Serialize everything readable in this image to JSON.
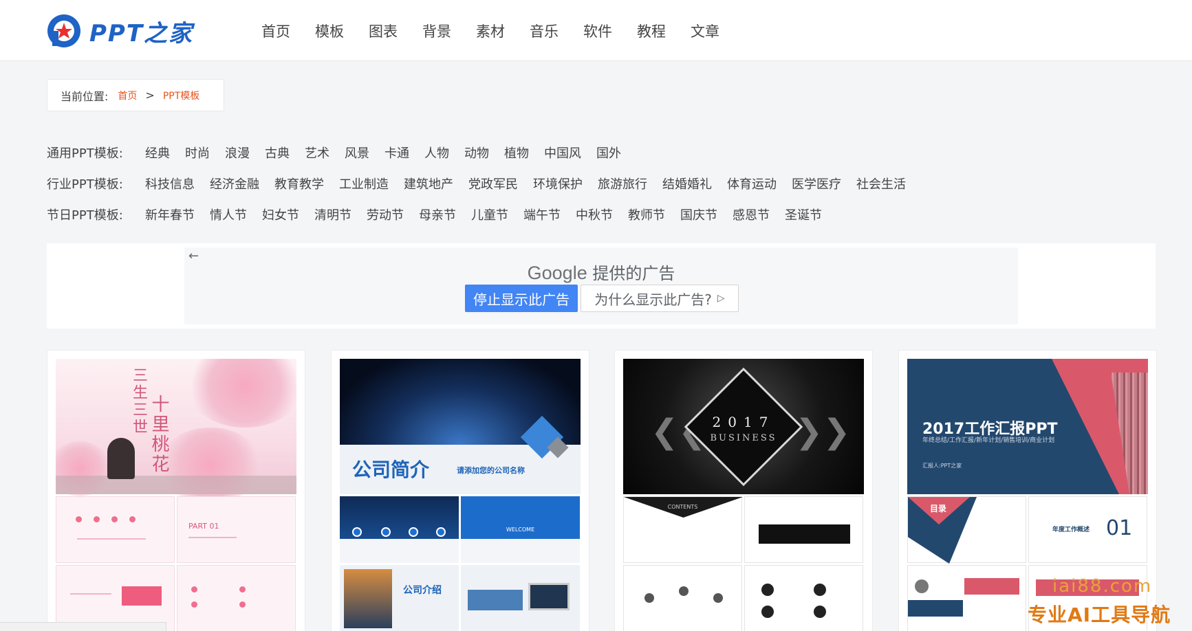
{
  "header": {
    "logo_text": "PPT之家",
    "nav": [
      "首页",
      "模板",
      "图表",
      "背景",
      "素材",
      "音乐",
      "软件",
      "教程",
      "文章"
    ]
  },
  "breadcrumb": {
    "label": "当前位置:",
    "home": "首页",
    "separator": ">",
    "current": "PPT模板"
  },
  "categories": [
    {
      "title": "通用PPT模板:",
      "items": [
        "经典",
        "时尚",
        "浪漫",
        "古典",
        "艺术",
        "风景",
        "卡通",
        "人物",
        "动物",
        "植物",
        "中国风",
        "国外"
      ]
    },
    {
      "title": "行业PPT模板:",
      "items": [
        "科技信息",
        "经济金融",
        "教育教学",
        "工业制造",
        "建筑地产",
        "党政军民",
        "环境保护",
        "旅游旅行",
        "结婚婚礼",
        "体育运动",
        "医学医疗",
        "社会生活"
      ]
    },
    {
      "title": "节日PPT模板:",
      "items": [
        "新年春节",
        "情人节",
        "妇女节",
        "清明节",
        "劳动节",
        "母亲节",
        "儿童节",
        "端午节",
        "中秋节",
        "教师节",
        "国庆节",
        "感恩节",
        "圣诞节"
      ]
    }
  ],
  "ad": {
    "brand": "Google",
    "title": "提供的广告",
    "stop_button": "停止显示此广告",
    "why_button": "为什么显示此广告?",
    "back_icon": "arrow-left-icon"
  },
  "cards": [
    {
      "vertical_text_1": "三生三世",
      "vertical_text_2": "十里桃花",
      "part_label": "PART 01"
    },
    {
      "title": "公司简介",
      "subtitle": "请添加您的公司名称",
      "welcome": "WELCOME",
      "section": "公司介绍"
    },
    {
      "year": "2017",
      "business": "BUSINESS",
      "contents": "CONTENTS"
    },
    {
      "title": "2017工作汇报PPT",
      "subtitle": "年终总结/工作汇报/新年计划/销售培训/商业计划",
      "author": "汇报人:PPT之家",
      "toc": "目录",
      "number": "01",
      "number_label": "年度工作概述"
    }
  ],
  "watermark": {
    "line1": "iai88.com",
    "line2": "专业AI工具导航"
  },
  "colors": {
    "brand_blue": "#1e63c5",
    "link_orange": "#e8541e",
    "ad_button_blue": "#4285f4"
  }
}
